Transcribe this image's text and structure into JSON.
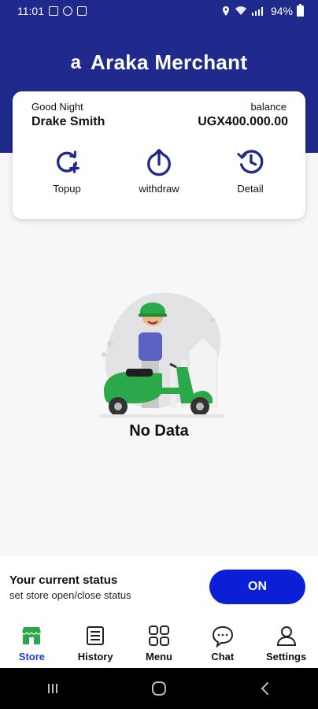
{
  "status_bar": {
    "time": "11:01",
    "battery": "94%"
  },
  "header": {
    "logo": "a",
    "title": "Araka Merchant"
  },
  "account": {
    "greeting": "Good Night",
    "name": "Drake Smith",
    "balance_label": "balance",
    "balance": "UGX400.000.00"
  },
  "actions": [
    {
      "label": "Topup",
      "icon": "topup-icon"
    },
    {
      "label": "withdraw",
      "icon": "withdraw-icon"
    },
    {
      "label": "Detail",
      "icon": "history-clock-icon"
    }
  ],
  "empty_state": {
    "text": "No Data"
  },
  "store_status": {
    "title": "Your current status",
    "subtitle": "set store open/close status",
    "toggle_label": "ON"
  },
  "bottom_nav": {
    "active": "Store",
    "items": [
      {
        "label": "Store",
        "icon": "store-icon"
      },
      {
        "label": "History",
        "icon": "history-list-icon"
      },
      {
        "label": "Menu",
        "icon": "menu-grid-icon"
      },
      {
        "label": "Chat",
        "icon": "chat-icon"
      },
      {
        "label": "Settings",
        "icon": "user-settings-icon"
      }
    ]
  },
  "colors": {
    "brand": "#1f2a8c",
    "accent": "#0b1fd6",
    "active_nav": "#1f3fd6",
    "store_icon": "#2aa84a"
  }
}
